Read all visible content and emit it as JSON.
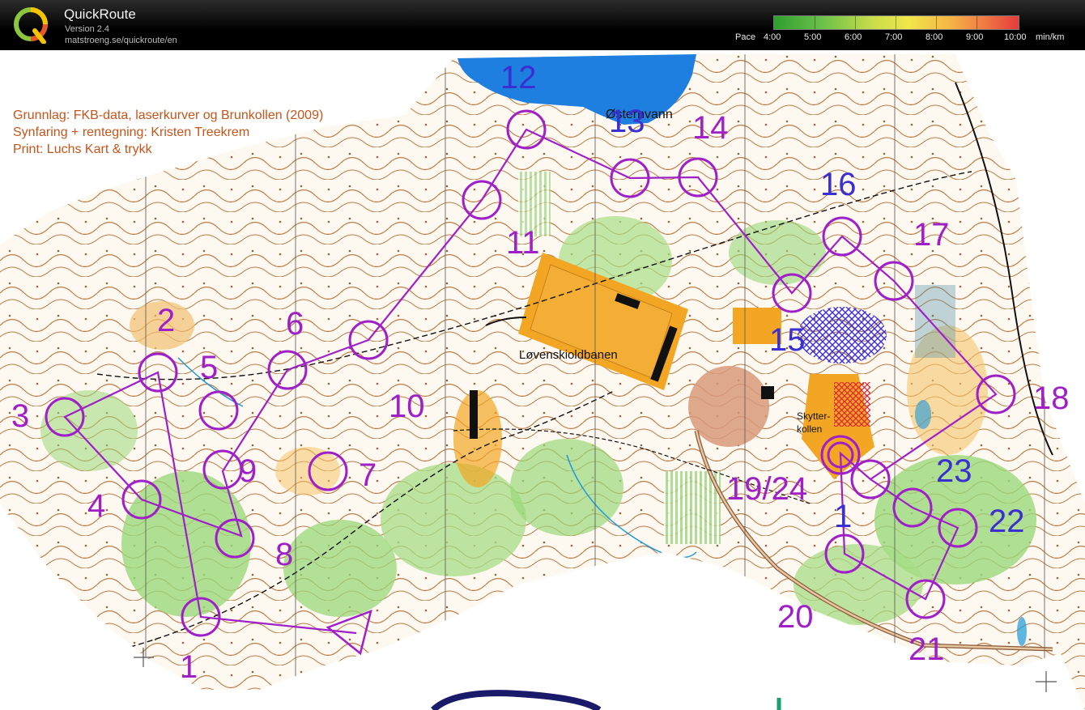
{
  "app": {
    "title": "QuickRoute",
    "version": "Version 2.4",
    "url": "matstroeng.se/quickroute/en",
    "logo_letter": "Q"
  },
  "pace_legend": {
    "label": "Pace",
    "ticks": [
      "4:00",
      "5:00",
      "6:00",
      "7:00",
      "8:00",
      "9:00",
      "10:00"
    ],
    "unit": "min/km",
    "colors": [
      "#2e9e2e",
      "#6cc14a",
      "#c7dd4a",
      "#f1e64a",
      "#f5b545",
      "#f07a42",
      "#e43b3b"
    ]
  },
  "map": {
    "credits": [
      "Grunnlag: FKB-data, laserkurver og Brunkollen (2009)",
      "Synfaring + rentegning: Kristen Treekrem",
      "Print: Luchs Kart & trykk"
    ],
    "place_labels": {
      "lake": "Østernvann",
      "field": "Løvenskioldbanen",
      "hill_line1": "Skytter-",
      "hill_line2": "kollen"
    },
    "control_labels": [
      "1",
      "2",
      "3",
      "4",
      "5",
      "6",
      "7",
      "8",
      "9",
      "10",
      "11",
      "12",
      "13",
      "14",
      "15",
      "16",
      "17",
      "18",
      "19/24",
      "20",
      "21",
      "22",
      "23",
      "1"
    ],
    "colors": {
      "course": "#a020c8",
      "water": "#1e7fe0",
      "vegetation": "#8fd66a",
      "contour": "#a0521d",
      "paved": "#f2a623"
    }
  }
}
